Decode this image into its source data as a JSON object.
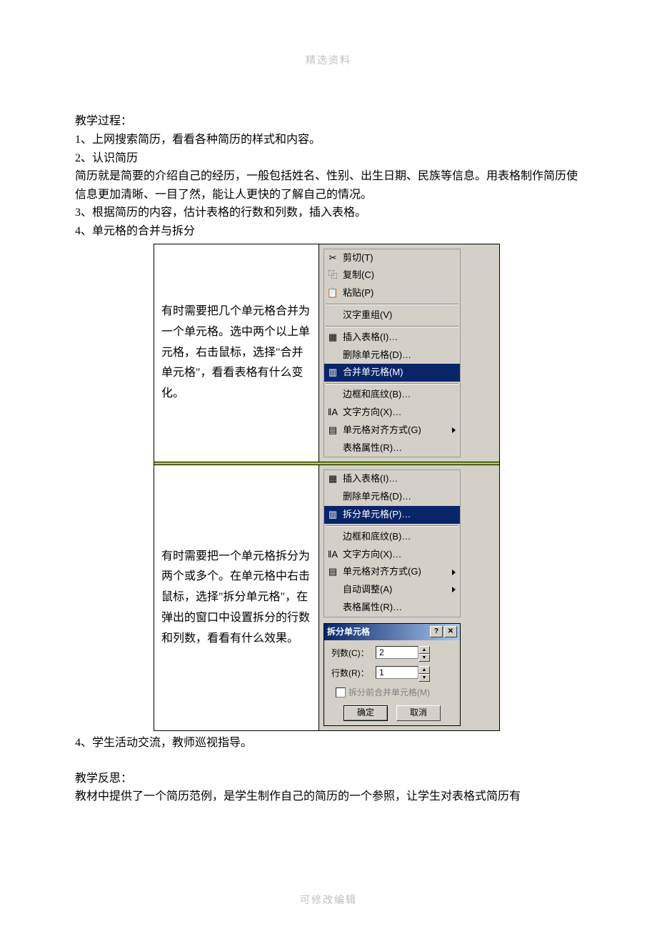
{
  "header": "精选资料",
  "footer": "可修改编辑",
  "body": {
    "p1": "教学过程：",
    "p2": "1、上网搜索简历，看看各种简历的样式和内容。",
    "p3": "2、认识简历",
    "p4": "简历就是简要的介绍自己的经历，一般包括姓名、性别、出生日期、民族等信息。用表格制作简历使信息更加清晰、一目了然，能让人更快的了解自己的情况。",
    "p5": "3、根据简历的内容，估计表格的行数和列数，插入表格。",
    "p6": "4、单元格的合并与拆分",
    "row1_left": "有时需要把几个单元格合并为一个单元格。选中两个以上单元格，右击鼠标，选择\"合并单元格\"，看看表格有什么变化。",
    "row2_left": "有时需要把一个单元格拆分为两个或多个。在单元格中右击鼠标，选择\"拆分单元格\"，在弹出的窗口中设置拆分的行数和列数，看看有什么效果。",
    "p7": "4、学生活动交流，教师巡视指导。",
    "p8": "教学反思：",
    "p9": "教材中提供了一个简历范例，是学生制作自己的简历的一个参照，让学生对表格式简历有"
  },
  "menu1": {
    "cut": "剪切(T)",
    "copy": "复制(C)",
    "paste": "粘贴(P)",
    "recompose": "汉字重组(V)",
    "insert_table": "插入表格(I)…",
    "delete_cell": "删除单元格(D)…",
    "merge_cell": "合并单元格(M)",
    "border": "边框和底纹(B)…",
    "text_dir": "文字方向(X)…",
    "align": "单元格对齐方式(G)",
    "props": "表格属性(R)…"
  },
  "menu2": {
    "insert_table": "插入表格(I)…",
    "delete_cell": "删除单元格(D)…",
    "split_cell": "拆分单元格(P)…",
    "border": "边框和底纹(B)…",
    "text_dir": "文字方向(X)…",
    "align": "单元格对齐方式(G)",
    "autofit": "自动调整(A)",
    "props": "表格属性(R)…"
  },
  "dialog": {
    "title": "拆分单元格",
    "cols_label": "列数(C)：",
    "cols_value": "2",
    "rows_label": "行数(R)：",
    "rows_value": "1",
    "checkbox": "拆分前合并单元格(M)",
    "ok": "确定",
    "cancel": "取消"
  }
}
